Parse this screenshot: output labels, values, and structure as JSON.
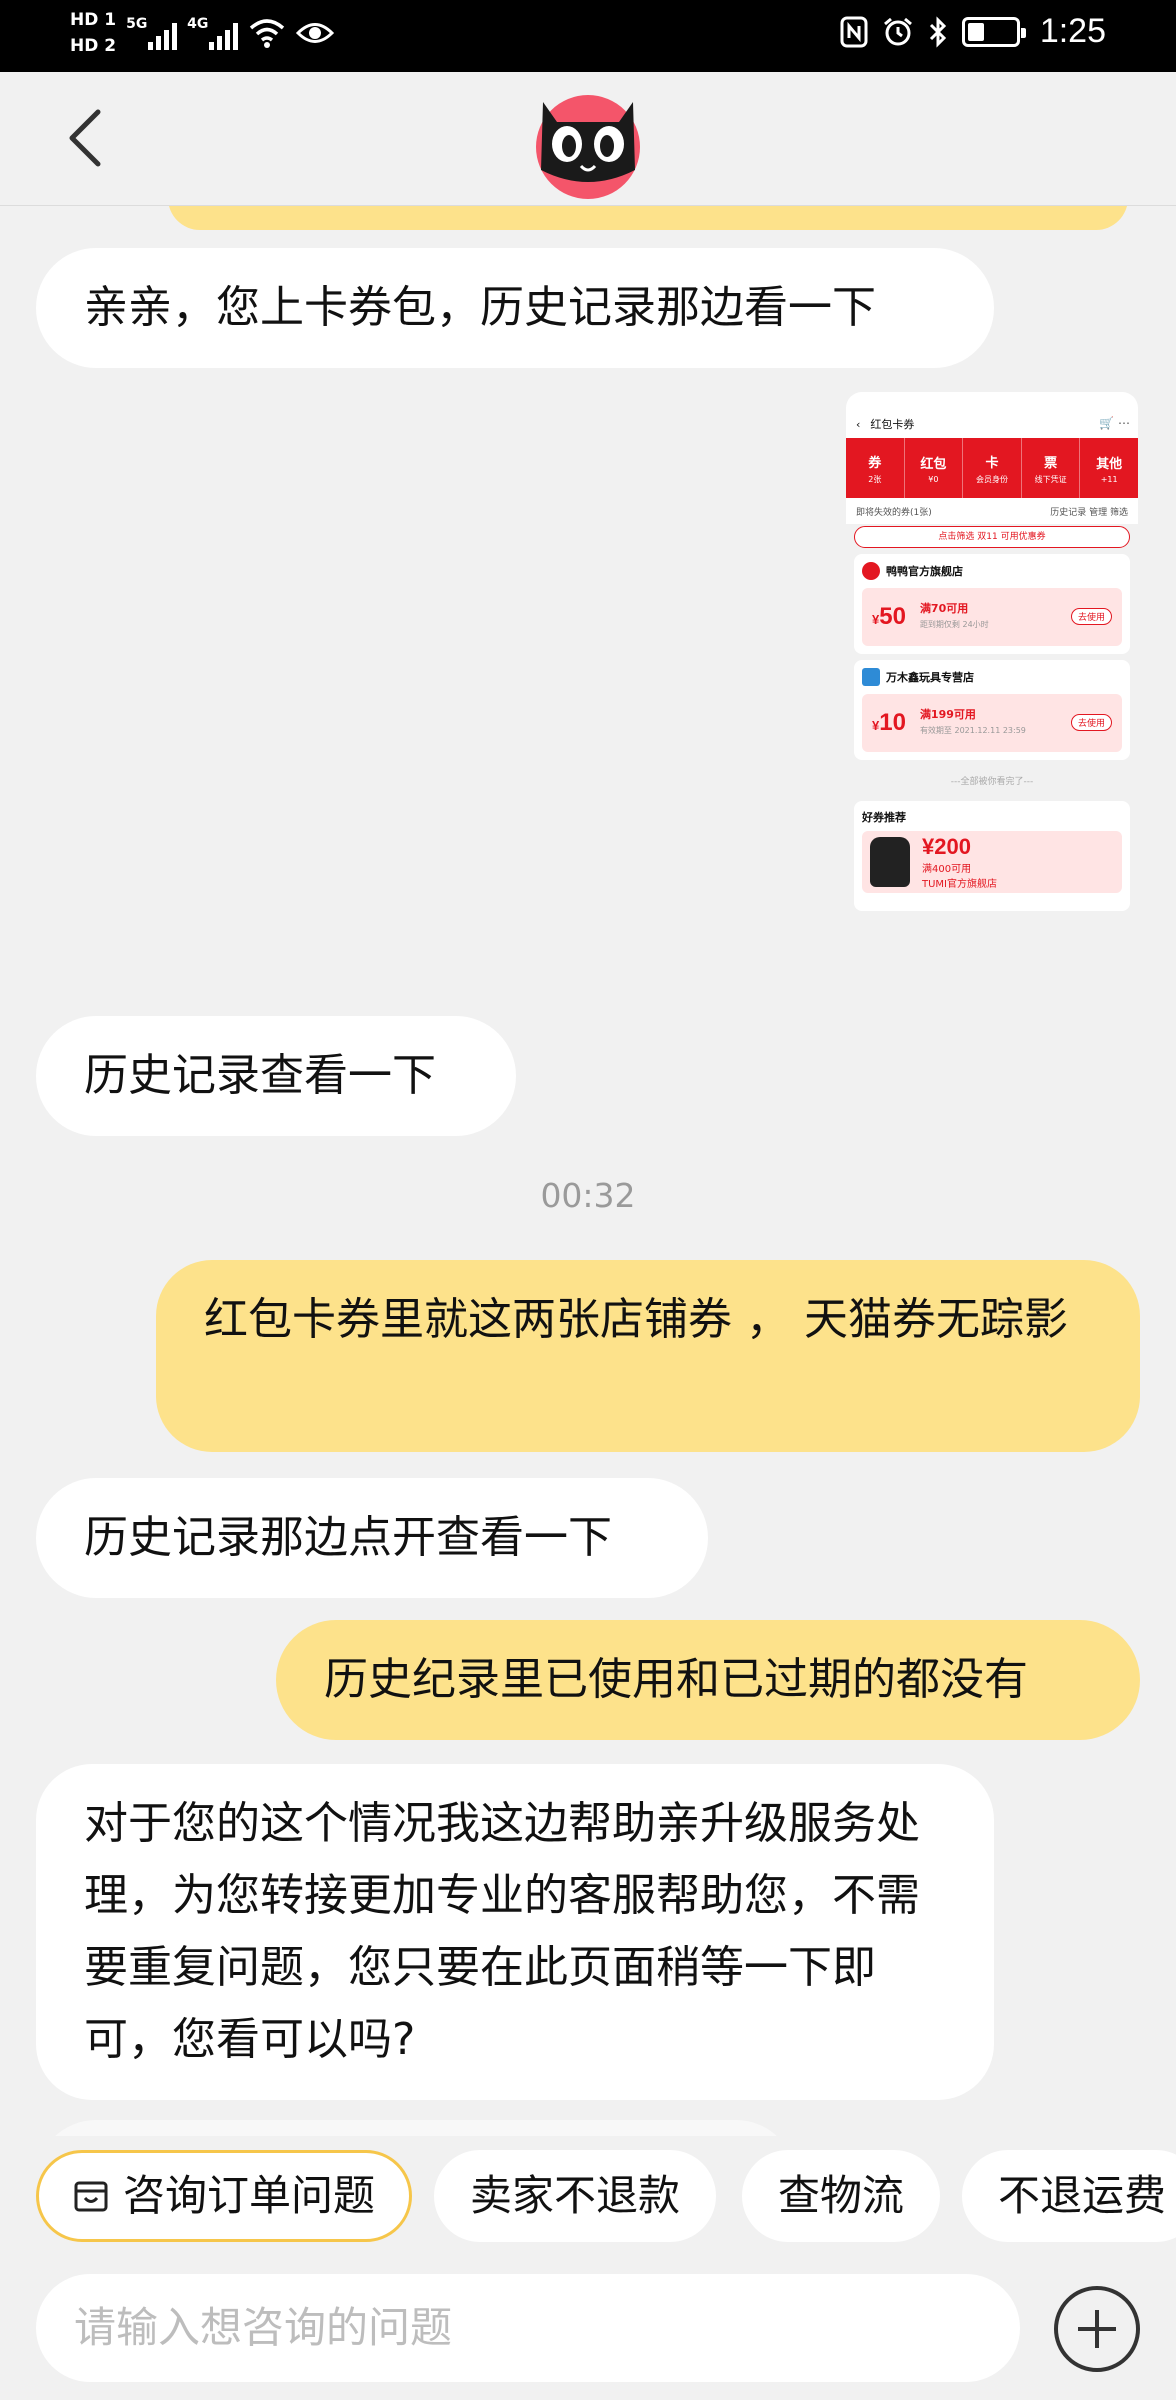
{
  "status_bar": {
    "hd1": "HD 1",
    "hd2": "HD 2",
    "net1": "5G",
    "net2": "4G",
    "time": "1:25",
    "battery_level": 0.35
  },
  "header": {
    "back_icon": "chevron-left-icon",
    "avatar": "tmall-cat-avatar"
  },
  "chat": {
    "messages": [
      {
        "side": "agent",
        "text": "亲亲，您上卡券包，历史记录那边看一下"
      },
      {
        "side": "agent",
        "type": "image",
        "text": ""
      },
      {
        "side": "agent",
        "text": "历史记录查看一下"
      },
      {
        "side": "user",
        "text": "红包卡券里就这两张店铺券 ， 天猫券无踪影"
      },
      {
        "side": "agent",
        "text": "历史记录那边点开查看一下"
      },
      {
        "side": "user",
        "text": "历史纪录里已使用和已过期的都没有"
      },
      {
        "side": "agent",
        "text": "对于您的这个情况我这边帮助亲升级服务处理，为您转接更加专业的客服帮助您，不需要重复问题，您只要在此页面稍等一下即可，您看可以吗?"
      }
    ],
    "timestamp": "00:32"
  },
  "screenshot": {
    "title": "红包卡券",
    "tabs": [
      {
        "label": "券",
        "sub": "2张"
      },
      {
        "label": "红包",
        "sub": "¥0"
      },
      {
        "label": "卡",
        "sub": "会员身份"
      },
      {
        "label": "票",
        "sub": "线下凭证"
      },
      {
        "label": "其他",
        "sub": "+11"
      }
    ],
    "filter_left": "即将失效的券(1张)",
    "filter_right": "历史记录   管理   筛选",
    "pill": "点击筛选 双11 可用优惠券",
    "cards": [
      {
        "shop": "鸭鸭官方旗舰店",
        "currency": "¥",
        "amount": "50",
        "cond": "满70可用",
        "note": "距到期仅剩 24小时",
        "use": "去使用"
      },
      {
        "shop": "万木鑫玩具专营店",
        "currency": "¥",
        "amount": "10",
        "cond": "满199可用",
        "note": "有效期至 2021.12.11 23:59",
        "use": "去使用"
      }
    ],
    "end_text": "---全部被你看完了---",
    "rec_title": "好券推荐",
    "rec_amount": "¥200",
    "rec_cond": "满400可用",
    "rec_shop": "TUMI官方旗舰店"
  },
  "quick_replies": [
    {
      "label": "咨询订单问题",
      "icon": "order-icon"
    },
    {
      "label": "卖家不退款"
    },
    {
      "label": "查物流"
    },
    {
      "label": "不退运费"
    }
  ],
  "input": {
    "placeholder": "请输入想咨询的问题",
    "plus_icon": "plus-circle-icon"
  }
}
